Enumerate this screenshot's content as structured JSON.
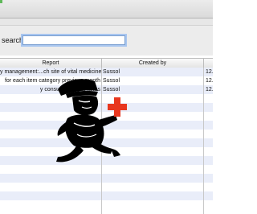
{
  "colors": {
    "row_alt": "#e9edf9",
    "search_focus": "#a9c6ef",
    "cross_red": "#e8371f"
  },
  "search": {
    "label": "search",
    "value": ""
  },
  "grid": {
    "columns": [
      "Report",
      "Created by",
      ""
    ],
    "rows": [
      {
        "report": "y management:...ch site of vital medicines",
        "created_by": "Sussol",
        "date": "12."
      },
      {
        "report": "for each item category previous month",
        "created_by": "Sussol",
        "date": "12."
      },
      {
        "report": "y consumption- all items",
        "created_by": "Sussol",
        "date": "12."
      }
    ]
  },
  "mascot": {
    "icon": "running-pharmacist-with-red-cross-icon"
  }
}
